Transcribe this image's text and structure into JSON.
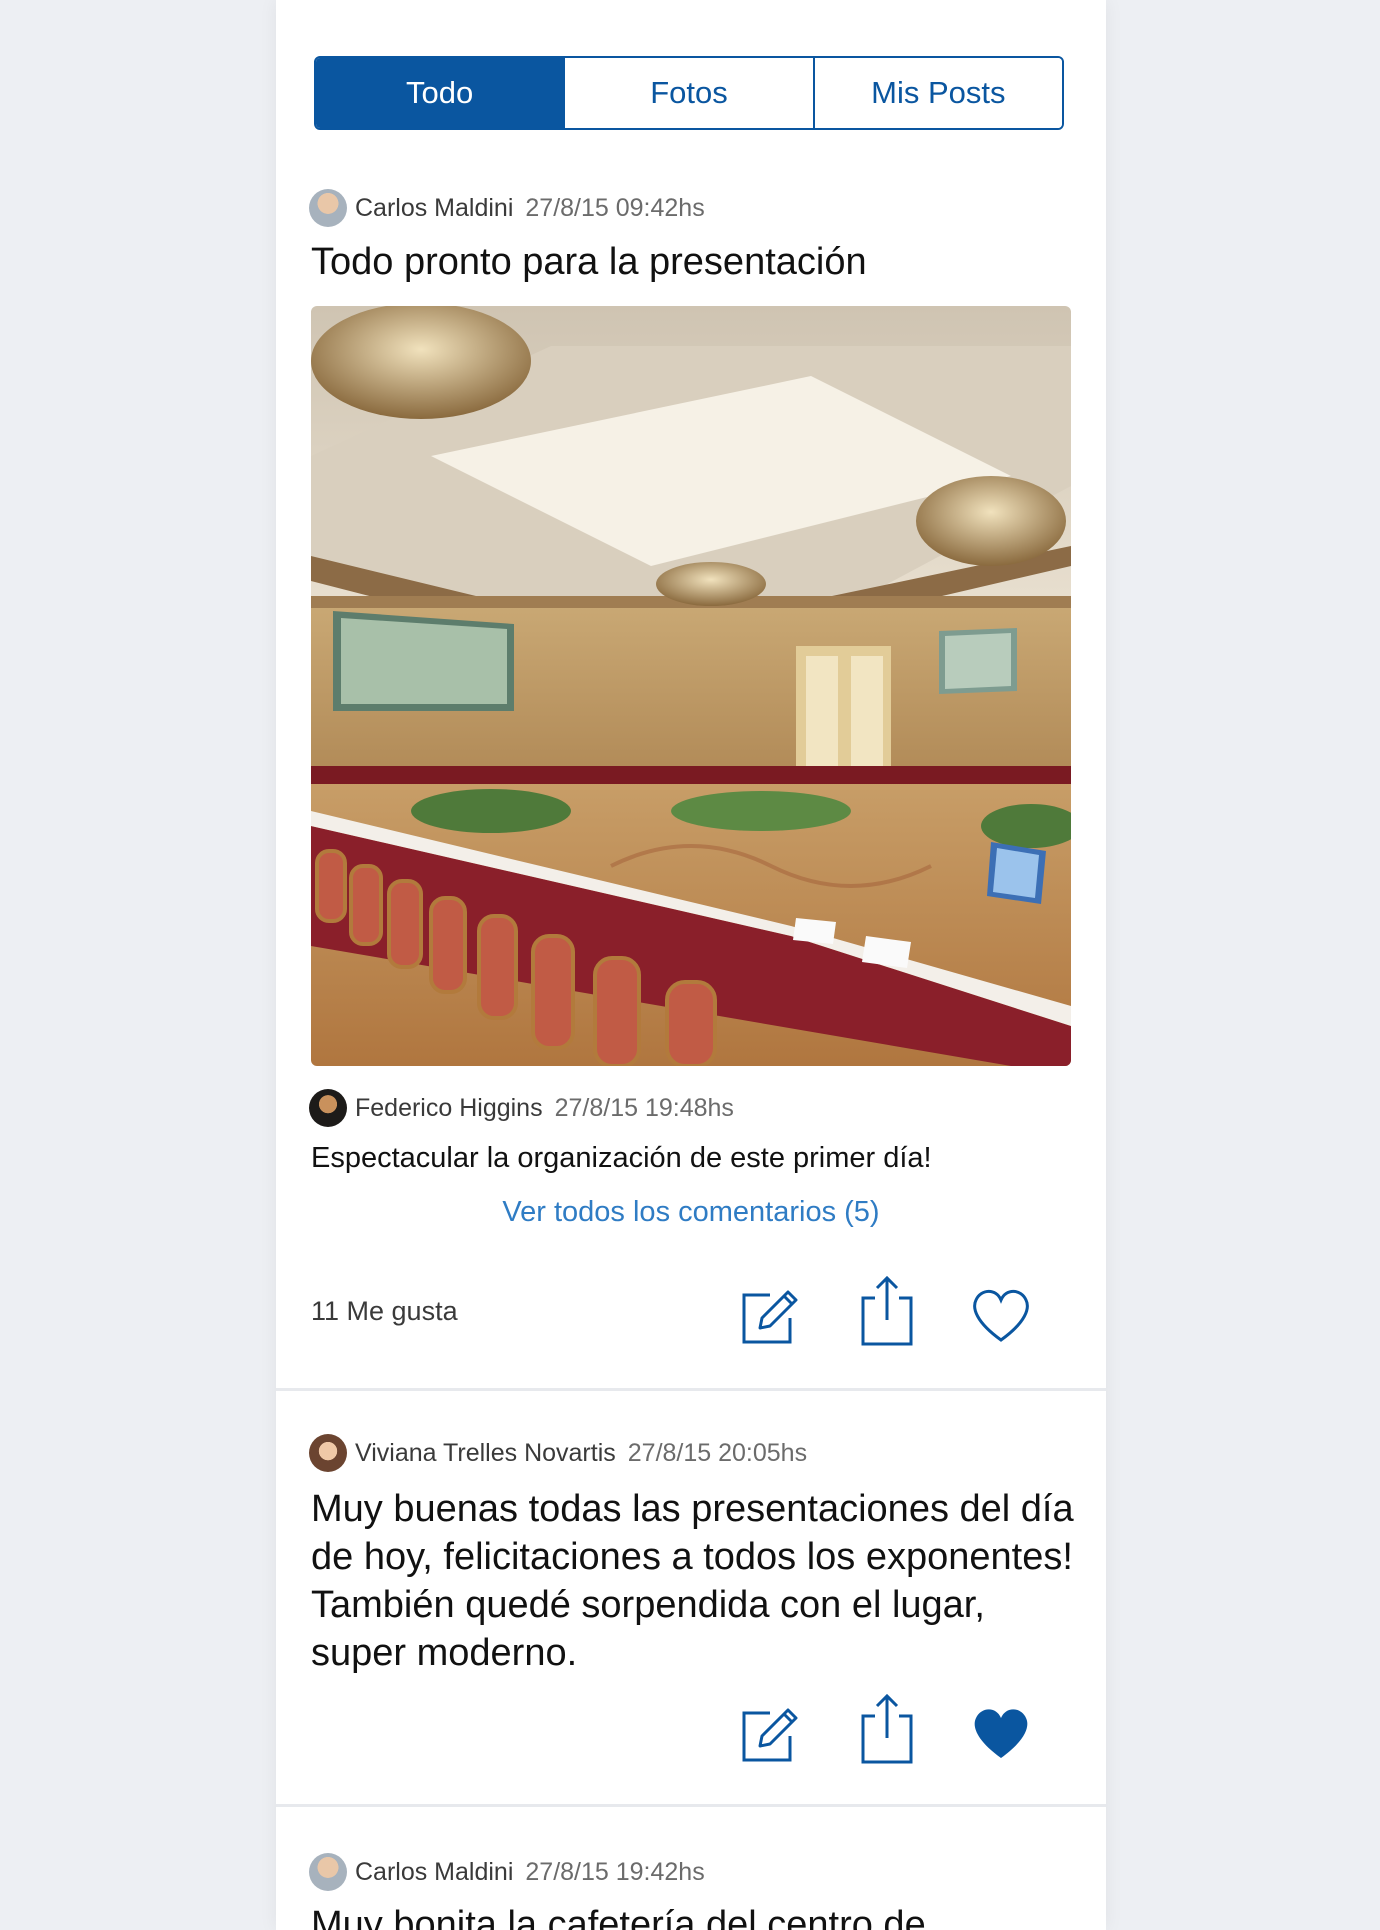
{
  "tabs": {
    "todo": "Todo",
    "fotos": "Fotos",
    "mis_posts": "Mis Posts",
    "active": "Todo"
  },
  "posts": [
    {
      "author": "Carlos Maldini",
      "time": "27/8/15 09:42hs",
      "title": "Todo pronto para la presentación",
      "has_photo": true,
      "comment": {
        "author": "Federico Higgins",
        "time": "27/8/15 19:48hs",
        "text": "Espectacular la organización de este primer día!"
      },
      "see_all": "Ver todos los comentarios (5)",
      "likes": "11 Me gusta",
      "liked": false
    },
    {
      "author": "Viviana Trelles Novartis",
      "time": "27/8/15 20:05hs",
      "title": "Muy buenas todas las presentaciones del día de hoy, felicitaciones a todos los exponentes! También quedé sorpendida con el lugar, super moderno.",
      "liked": true
    },
    {
      "author": "Carlos Maldini",
      "time": "27/8/15 19:42hs",
      "title": "Muy bonita la cafetería del centro de"
    }
  ],
  "icons": {
    "edit": "edit-icon",
    "share": "share-icon",
    "like": "heart-outline-icon",
    "liked": "heart-filled-icon"
  },
  "colors": {
    "brand_blue": "#0a56a0",
    "link_blue": "#2f7cc4",
    "background": "#edeff3"
  }
}
